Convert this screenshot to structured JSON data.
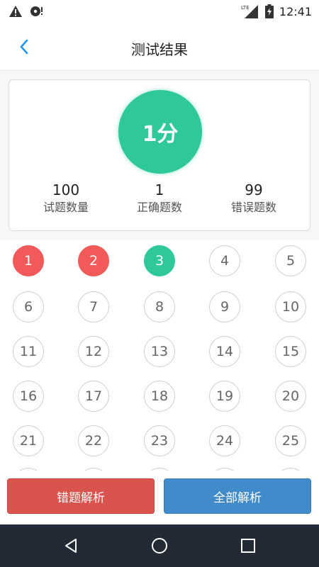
{
  "status_bar": {
    "network_label": "LTE",
    "time": "12:41"
  },
  "header": {
    "title": "测试结果",
    "back_icon": "chevron-left-icon"
  },
  "result": {
    "score": "1分",
    "stats": [
      {
        "value": "100",
        "label": "试题数量"
      },
      {
        "value": "1",
        "label": "正确题数"
      },
      {
        "value": "99",
        "label": "错误题数"
      }
    ]
  },
  "questions": [
    {
      "num": "1",
      "state": "wrong"
    },
    {
      "num": "2",
      "state": "wrong"
    },
    {
      "num": "3",
      "state": "correct"
    },
    {
      "num": "4",
      "state": "unanswered"
    },
    {
      "num": "5",
      "state": "unanswered"
    },
    {
      "num": "6",
      "state": "unanswered"
    },
    {
      "num": "7",
      "state": "unanswered"
    },
    {
      "num": "8",
      "state": "unanswered"
    },
    {
      "num": "9",
      "state": "unanswered"
    },
    {
      "num": "10",
      "state": "unanswered"
    },
    {
      "num": "11",
      "state": "unanswered"
    },
    {
      "num": "12",
      "state": "unanswered"
    },
    {
      "num": "13",
      "state": "unanswered"
    },
    {
      "num": "14",
      "state": "unanswered"
    },
    {
      "num": "15",
      "state": "unanswered"
    },
    {
      "num": "16",
      "state": "unanswered"
    },
    {
      "num": "17",
      "state": "unanswered"
    },
    {
      "num": "18",
      "state": "unanswered"
    },
    {
      "num": "19",
      "state": "unanswered"
    },
    {
      "num": "20",
      "state": "unanswered"
    },
    {
      "num": "21",
      "state": "unanswered"
    },
    {
      "num": "22",
      "state": "unanswered"
    },
    {
      "num": "23",
      "state": "unanswered"
    },
    {
      "num": "24",
      "state": "unanswered"
    },
    {
      "num": "25",
      "state": "unanswered"
    },
    {
      "num": "",
      "state": "unanswered"
    },
    {
      "num": "",
      "state": "unanswered"
    },
    {
      "num": "",
      "state": "unanswered"
    },
    {
      "num": "",
      "state": "unanswered"
    },
    {
      "num": "",
      "state": "unanswered"
    }
  ],
  "actions": {
    "wrong_analysis_label": "错题解析",
    "all_analysis_label": "全部解析"
  },
  "colors": {
    "correct": "#2ec89a",
    "wrong": "#f25a5a",
    "wrong_button": "#d9534f",
    "all_button": "#428bca",
    "accent": "#2196f3",
    "nav_bar": "#222a36"
  }
}
